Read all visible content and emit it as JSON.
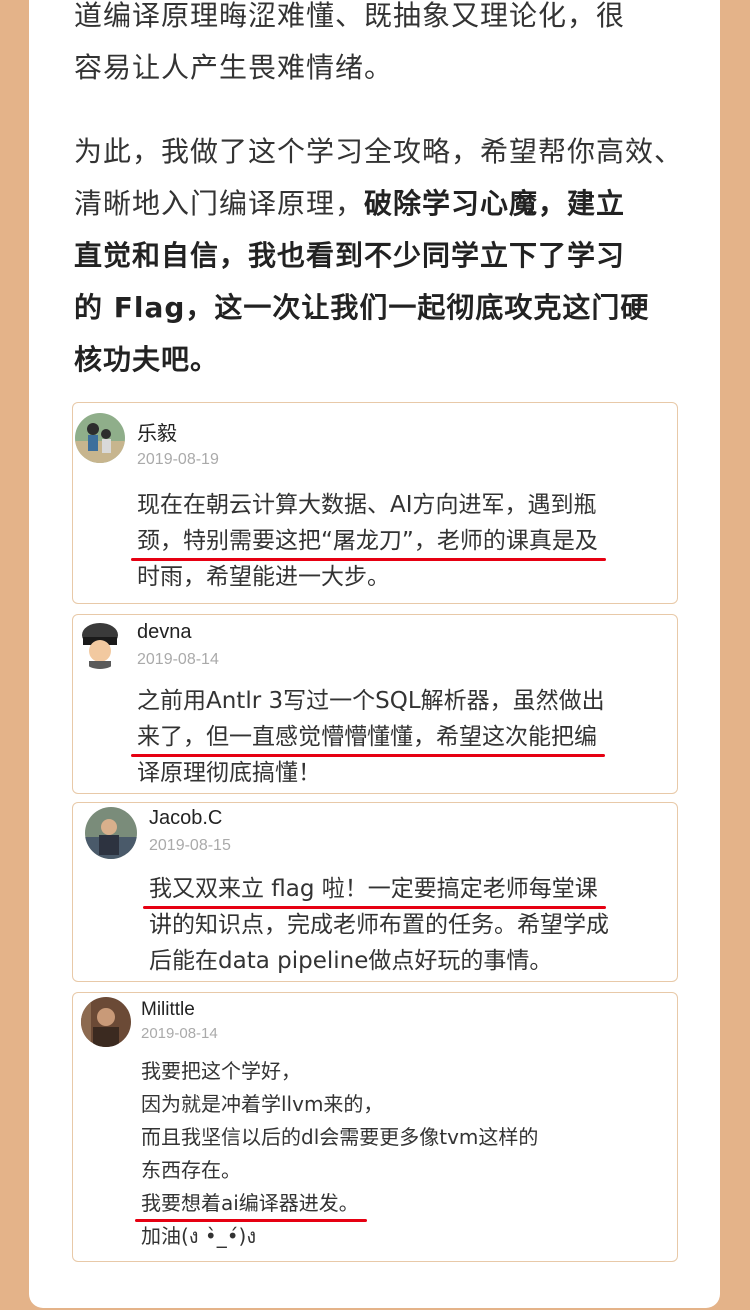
{
  "intro": {
    "p1_line1": "道编译原理晦涩难懂、既抽象又理论化，很",
    "p1_line2": "容易让人产生畏难情绪。",
    "p2_line1": "为此，我做了这个学习全攻略，希望帮你高效、",
    "p2_line2_normal": "清晰地入门编译原理，",
    "p2_line2_bold": "破除学习心魔，建立",
    "p2_line3_bold": "直觉和自信，我也看到不少同学立下了学习",
    "p2_line4_bold": "的 Flag，这一次让我们一起彻底攻克这门硬",
    "p2_line5_bold": "核功夫吧。"
  },
  "comments": [
    {
      "name": "乐毅",
      "date": "2019-08-19",
      "line1": "现在在朝云计算大数据、AI方向进军，遇到瓶",
      "line2": "颈，特别需要这把“屠龙刀”，老师的课真是及",
      "line3": "时雨，希望能进一大步。"
    },
    {
      "name": "devna",
      "date": "2019-08-14",
      "line1": "之前用Antlr 3写过一个SQL解析器，虽然做出",
      "line2": "来了，但一直感觉懵懵懂懂，希望这次能把编",
      "line3": "译原理彻底搞懂！"
    },
    {
      "name": "Jacob.C",
      "date": "2019-08-15",
      "line1": "我又双来立 flag 啦！一定要搞定老师每堂课",
      "line2": "讲的知识点，完成老师布置的任务。希望学成",
      "line3": "后能在data pipeline做点好玩的事情。"
    },
    {
      "name": "Milittle",
      "date": "2019-08-14",
      "line1": "我要把这个学好，",
      "line2": "因为就是冲着学llvm来的，",
      "line3": "而且我坚信以后的dl会需要更多像tvm这样的",
      "line4": "东西存在。",
      "line5": "我要想着ai编译器进发。",
      "line6": "加油(ง •̀_•́)ง"
    }
  ],
  "colors": {
    "background": "#e4b389",
    "underline": "#e60012",
    "card_border": "#e8c9a8"
  }
}
